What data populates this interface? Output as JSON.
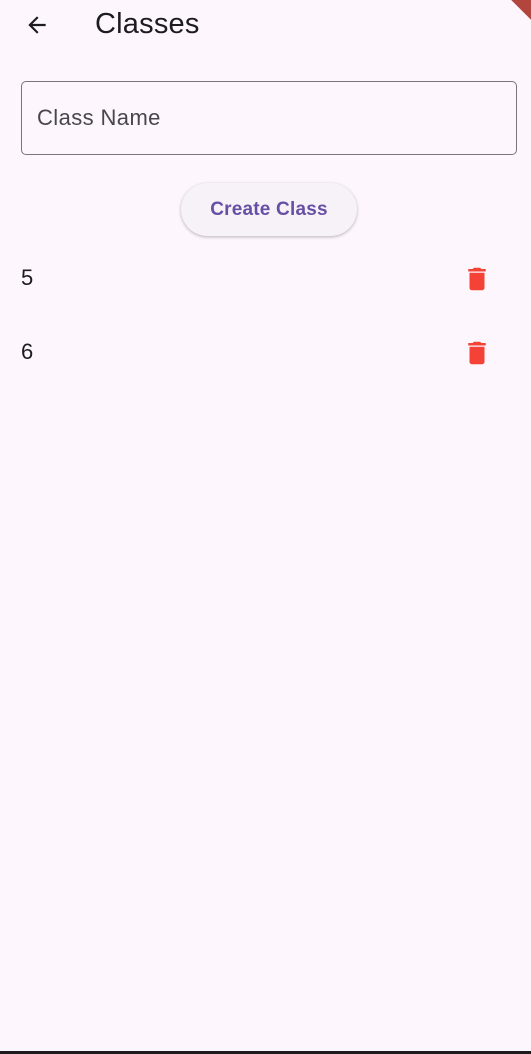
{
  "header": {
    "title": "Classes",
    "back_icon": "arrow-back-icon"
  },
  "form": {
    "class_name_placeholder": "Class Name",
    "class_name_value": "",
    "create_button_label": "Create Class"
  },
  "classes": [
    {
      "name": "5",
      "delete_icon": "trash-icon"
    },
    {
      "name": "6",
      "delete_icon": "trash-icon"
    }
  ],
  "colors": {
    "background": "#fdf7fd",
    "accent": "#6750a4",
    "delete": "#f44336",
    "outline": "#79747e"
  }
}
